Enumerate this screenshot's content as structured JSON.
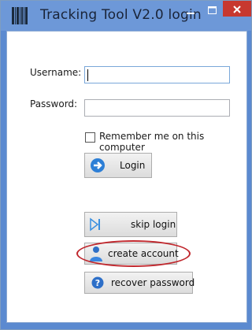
{
  "window": {
    "title": "Tracking Tool V2.0 login",
    "controls": {
      "minimize": "–",
      "maximize": "☐",
      "close": "✕"
    }
  },
  "form": {
    "username_label": "Username:",
    "username_value": "",
    "password_label": "Password:",
    "password_value": "",
    "remember_label": "Remember me on this computer",
    "remember_checked": false
  },
  "buttons": {
    "login": "Login",
    "skip_login": "skip login",
    "create_account": "create account",
    "recover_password": "recover password"
  },
  "colors": {
    "titlebar": "#6d98d8",
    "close_button": "#c7382f",
    "highlight": "#c0272d"
  }
}
